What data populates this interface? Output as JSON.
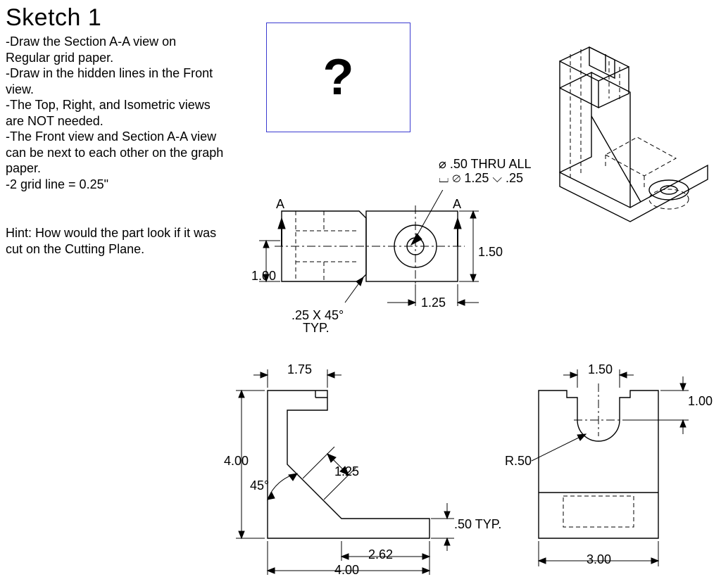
{
  "title": "Sketch 1",
  "instructions": [
    "-Draw the Section A-A view on Regular grid paper.",
    "-Draw in the hidden lines in the Front view.",
    "-The Top, Right, and Isometric views are NOT needed.",
    "-The Front view and Section A-A view can be next to each other on the graph paper.",
    "-2 grid line = 0.25\""
  ],
  "hint": "Hint: How would the part look if it was cut on the Cutting Plane.",
  "question_mark": "?",
  "callouts": {
    "hole_note_line1": "⌀ .50 THRU ALL",
    "hole_note_line2": "⌴ ⌀ 1.25 ⌵ .25",
    "section_label_left": "A",
    "section_label_right": "A",
    "chamfer": ".25 X 45°",
    "chamfer_sub": "TYP."
  },
  "top_view_dims": {
    "height_left": "1.00",
    "height_right": "1.50",
    "offset_right": "1.25"
  },
  "front_view_dims": {
    "top_offset": "1.75",
    "height": "4.00",
    "angle": "45°",
    "rib": "1.25",
    "base": ".50 TYP.",
    "inner_width": "2.62",
    "full_width": "4.00"
  },
  "right_view_dims": {
    "slot_width": "1.50",
    "slot_depth": "1.00",
    "radius": "R.50",
    "width": "3.00"
  },
  "chart_data": {
    "type": "engineering-drawing",
    "units": "inches",
    "scale_note": "2 grid line = 0.25\"",
    "views": {
      "section_target": "Section A-A (to be drawn by student)",
      "top": {
        "overall_depth": 1.5,
        "left_block_depth": 1.0,
        "hole_from_right_edge": 1.25,
        "chamfer": {
          "size": 0.25,
          "angle_deg": 45,
          "typ": true
        },
        "counterbore": {
          "thru_dia": 0.5,
          "cbore_dia": 1.25,
          "cbore_depth": 0.25
        },
        "section_arrows": "A-A pointing up"
      },
      "front": {
        "overall_height": 4.0,
        "overall_width": 4.0,
        "top_arm_width": 1.75,
        "rib_thickness": 1.25,
        "rib_angle_deg": 45,
        "base_thickness": 0.5,
        "base_thickness_typ": true,
        "toe_length": 2.62
      },
      "right": {
        "overall_width": 3.0,
        "slot_width": 1.5,
        "slot_depth": 1.0,
        "slot_bottom_radius": 0.5
      },
      "isometric": "reference only"
    }
  }
}
